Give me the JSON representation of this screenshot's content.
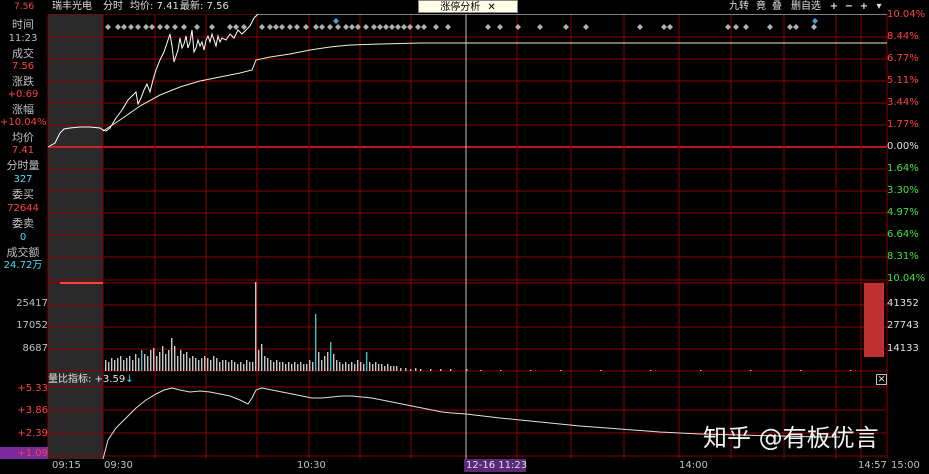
{
  "header": {
    "stock_name": "瑞丰光电",
    "mode": "分时",
    "avg_text": "均价: 7.41",
    "latest_text": "最新: 7.56",
    "top_left_price": "7.56",
    "tab_analysis": "涨停分析",
    "tab_close": "✕",
    "btn_jiuzhuan": "九转",
    "btn_jing": "竟",
    "btn_die": "叠",
    "btn_del": "删自选",
    "btn_add": "+",
    "btn_minus": "−",
    "btn_plus2": "+",
    "btn_dropdown": "▾"
  },
  "sidebar": {
    "items": [
      {
        "label": "时间",
        "value": "11:23",
        "color": "#c0c0c0"
      },
      {
        "label": "成交",
        "value": "7.56",
        "color": "#ff4040"
      },
      {
        "label": "涨跌",
        "value": "+0.69",
        "color": "#ff4040"
      },
      {
        "label": "涨幅",
        "value": "+10.04%",
        "color": "#ff4040"
      },
      {
        "label": "均价",
        "value": "7.41",
        "color": "#ff4040"
      },
      {
        "label": "分时量",
        "value": "327",
        "color": "#40e0ff"
      },
      {
        "label": "委买",
        "value": "72644",
        "color": "#ff4040"
      },
      {
        "label": "委卖",
        "value": "0",
        "color": "#40e0ff"
      },
      {
        "label": "成交额",
        "value": "24.72万",
        "color": "#40e0ff"
      }
    ]
  },
  "price_axis_right": {
    "up": [
      "10.04%",
      "8.44%",
      "6.77%",
      "5.11%",
      "3.44%",
      "1.77%"
    ],
    "zero": "0.00%",
    "down": [
      "1.64%",
      "3.30%",
      "4.97%",
      "6.64%",
      "8.31%",
      "10.04%"
    ]
  },
  "volume_axis_left": [
    "25417",
    "17052",
    "8687"
  ],
  "volume_axis_right": [
    "41352",
    "27743",
    "14133"
  ],
  "indicator": {
    "title": "量比指标: +3.59",
    "arrow": "↓",
    "left_axis": [
      "+5.33",
      "+3.86",
      "+2.39",
      "+1.09"
    ],
    "close_icon": "✕"
  },
  "time_axis": {
    "labels": [
      "09:15",
      "09:30",
      "10:30",
      "14:00",
      "14:57",
      "15:00"
    ],
    "cursor_label": "12-16 11:23"
  },
  "watermark": "知乎 @有板优言",
  "colors": {
    "grid": "#8b0000",
    "price_line": "#ffffff",
    "avg_line": "#f0f0c0",
    "volume_bar": "#c8c8c8",
    "volume_bar_cyan": "#40c0c0",
    "up": "#ff4040",
    "down": "#40e0ff",
    "zero_line": "#ff2020"
  },
  "chart_data": {
    "type": "line",
    "title": "瑞丰光电 分时",
    "x": [
      "09:30",
      "10:30",
      "11:23",
      "14:00",
      "15:00"
    ],
    "series": [
      {
        "name": "最新",
        "values": [
          6.95,
          7.56,
          7.56,
          7.56,
          7.56
        ]
      },
      {
        "name": "均价",
        "values": [
          6.92,
          7.35,
          7.41,
          7.41,
          7.41
        ]
      }
    ],
    "ylim_pct": [
      -10.04,
      10.04
    ]
  }
}
